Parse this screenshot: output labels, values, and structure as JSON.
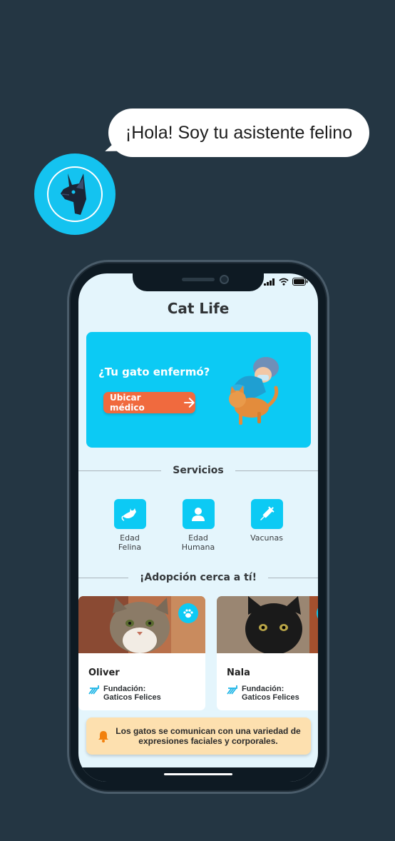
{
  "assistant": {
    "greeting": "¡Hola! Soy tu asistente felino",
    "icon": "cat-head-icon"
  },
  "app": {
    "title": "Cat Life"
  },
  "banner": {
    "question": "¿Tu gato enfermó?",
    "button_label": "Ubicar médico",
    "icon": "arrow-right-icon"
  },
  "services": {
    "heading": "Servicios",
    "items": [
      {
        "label": "Edad\nFelina",
        "icon": "cat-age-icon"
      },
      {
        "label": "Edad\nHumana",
        "icon": "person-icon"
      },
      {
        "label": "Vacunas",
        "icon": "syringe-icon"
      }
    ]
  },
  "adoption": {
    "heading": "¡Adopción cerca a tí!",
    "cards": [
      {
        "name": "Oliver",
        "org": "Fundación:\nGaticos Felices",
        "icon": "paw-icon"
      },
      {
        "name": "Nala",
        "org": "Fundación:\nGaticos Felices",
        "icon": "paw-icon"
      }
    ]
  },
  "tip": {
    "text": "Los gatos se comunican con una variedad de expresiones faciales y corporales.",
    "icon": "bell-icon"
  },
  "colors": {
    "background": "#243643",
    "accent": "#0ccaf4",
    "button": "#f06a3e",
    "tip_background": "#fde0af",
    "screen": "#e4f5fc"
  }
}
